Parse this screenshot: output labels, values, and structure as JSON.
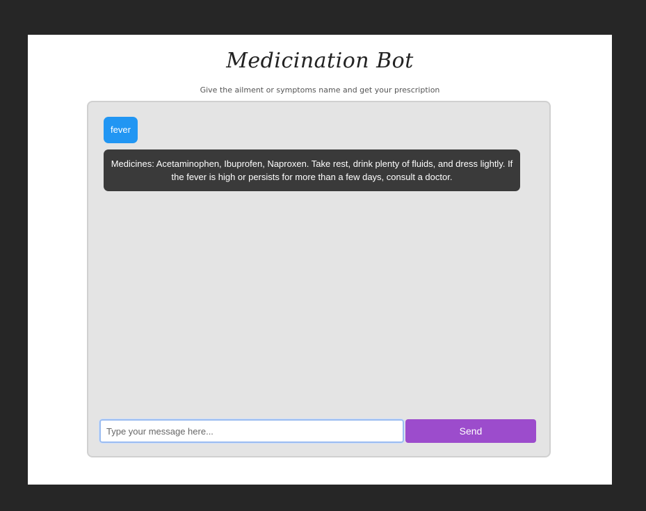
{
  "app": {
    "title": "Medicination Bot",
    "subtitle": "Give the ailment or symptoms name and get your prescription"
  },
  "chat": {
    "messages": [
      {
        "sender": "user",
        "text": "fever"
      },
      {
        "sender": "bot",
        "text": "Medicines: Acetaminophen, Ibuprofen, Naproxen. Take rest, drink plenty of fluids, and dress lightly. If the fever is high or persists for more than a few days, consult a doctor."
      }
    ]
  },
  "composer": {
    "placeholder": "Type your message here...",
    "value": "",
    "send_label": "Send"
  },
  "colors": {
    "page_background": "#262626",
    "user_bubble": "#2196f3",
    "bot_bubble": "#3a3a3a",
    "send_button": "#9c4ccc",
    "chat_background": "#e4e4e4"
  }
}
